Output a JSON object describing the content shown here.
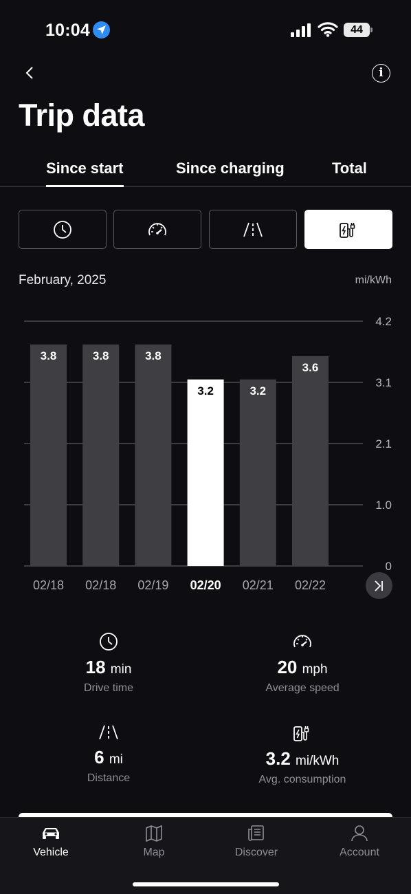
{
  "status_bar": {
    "time": "10:04",
    "battery": "44"
  },
  "header": {
    "title": "Trip data"
  },
  "tabs": [
    {
      "label": "Since start",
      "active": true
    },
    {
      "label": "Since charging",
      "active": false
    },
    {
      "label": "Total",
      "active": false
    }
  ],
  "metric_buttons": [
    {
      "icon": "clock-icon",
      "selected": false
    },
    {
      "icon": "speedometer-icon",
      "selected": false
    },
    {
      "icon": "road-icon",
      "selected": false
    },
    {
      "icon": "ev-charging-icon",
      "selected": true
    }
  ],
  "chart_header": {
    "month": "February, 2025",
    "unit": "mi/kWh"
  },
  "chart_data": {
    "type": "bar",
    "categories": [
      "02/18",
      "02/18",
      "02/19",
      "02/20",
      "02/21",
      "02/22"
    ],
    "values": [
      3.8,
      3.8,
      3.8,
      3.2,
      3.2,
      3.6
    ],
    "value_labels": [
      "3.8",
      "3.8",
      "3.8",
      "3.2",
      "3.2",
      "3.6"
    ],
    "selected_index": 3,
    "ylabel": "mi/kWh",
    "ylim": [
      0,
      4.2
    ],
    "y_ticks": [
      0,
      1.05,
      2.1,
      3.15,
      4.2
    ],
    "y_tick_labels": [
      "0",
      "1.0",
      "2.1",
      "3.1",
      "4.2"
    ],
    "grid": true,
    "colors": {
      "bar": "#3f3f43",
      "selected_bar": "#ffffff",
      "grid": "#6a6a70"
    }
  },
  "stats": {
    "drive_time": {
      "value": "18",
      "unit": "min",
      "caption": "Drive time"
    },
    "average_speed": {
      "value": "20",
      "unit": "mph",
      "caption": "Average speed"
    },
    "distance": {
      "value": "6",
      "unit": "mi",
      "caption": "Distance"
    },
    "avg_consumption": {
      "value": "3.2",
      "unit": "mi/kWh",
      "caption": "Avg. consumption"
    }
  },
  "bottom_nav": [
    {
      "label": "Vehicle",
      "icon": "car-icon",
      "active": true
    },
    {
      "label": "Map",
      "icon": "map-icon",
      "active": false
    },
    {
      "label": "Discover",
      "icon": "news-icon",
      "active": false
    },
    {
      "label": "Account",
      "icon": "person-icon",
      "active": false
    }
  ]
}
